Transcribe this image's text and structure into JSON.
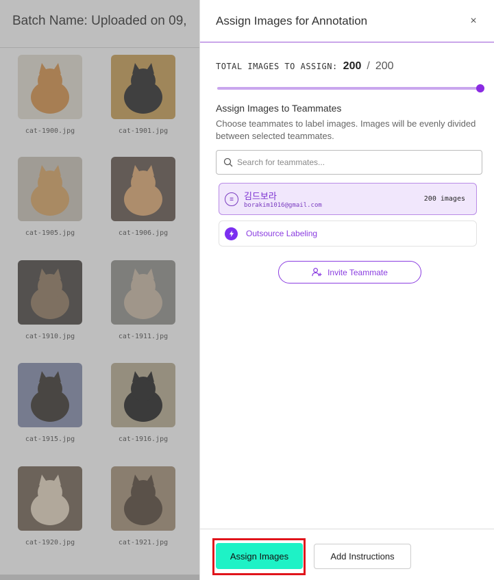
{
  "background": {
    "batch_title": "Batch Name: Uploaded on 09,",
    "thumbnails": [
      {
        "label": "cat-1900.jpg",
        "tone": "#d68a3c",
        "bg": "#e2dccf"
      },
      {
        "label": "cat-1901.jpg",
        "tone": "#1b1b1b",
        "bg": "#c79a4a"
      },
      {
        "label": "cat-1905.jpg",
        "tone": "#d9a05a",
        "bg": "#c9c1b4"
      },
      {
        "label": "cat-1906.jpg",
        "tone": "#e0a66a",
        "bg": "#5a4b42"
      },
      {
        "label": "cat-1910.jpg",
        "tone": "#8a7156",
        "bg": "#3e3a35"
      },
      {
        "label": "cat-1911.jpg",
        "tone": "#c9b6a0",
        "bg": "#8a8a86"
      },
      {
        "label": "cat-1915.jpg",
        "tone": "#2b2620",
        "bg": "#7d86a8"
      },
      {
        "label": "cat-1916.jpg",
        "tone": "#111111",
        "bg": "#b4a88a"
      },
      {
        "label": "cat-1920.jpg",
        "tone": "#e8d8c0",
        "bg": "#6a5a4a"
      },
      {
        "label": "cat-1921.jpg",
        "tone": "#4a3a2a",
        "bg": "#a08a70"
      }
    ]
  },
  "drawer": {
    "title": "Assign Images for Annotation",
    "close_symbol": "×",
    "total_label": "TOTAL IMAGES TO ASSIGN:",
    "total_value": "200",
    "total_separator": "/",
    "total_max": "200",
    "slider_fraction": 1.0,
    "section_title": "Assign Images to Teammates",
    "section_description": "Choose teammates to label images. Images will be evenly divided between selected teammates.",
    "search_placeholder": "Search for teammates...",
    "teammates": [
      {
        "name": "김드보라",
        "email": "borakim1016@gmail.com",
        "count": "200 images",
        "selected": true
      }
    ],
    "outsource_label": "Outsource Labeling",
    "invite_label": "Invite Teammate",
    "assign_button": "Assign Images",
    "instructions_button": "Add Instructions"
  },
  "colors": {
    "accent": "#8a2be2",
    "assign_button": "#1ef2c6",
    "highlight_outline": "#e0141b"
  }
}
